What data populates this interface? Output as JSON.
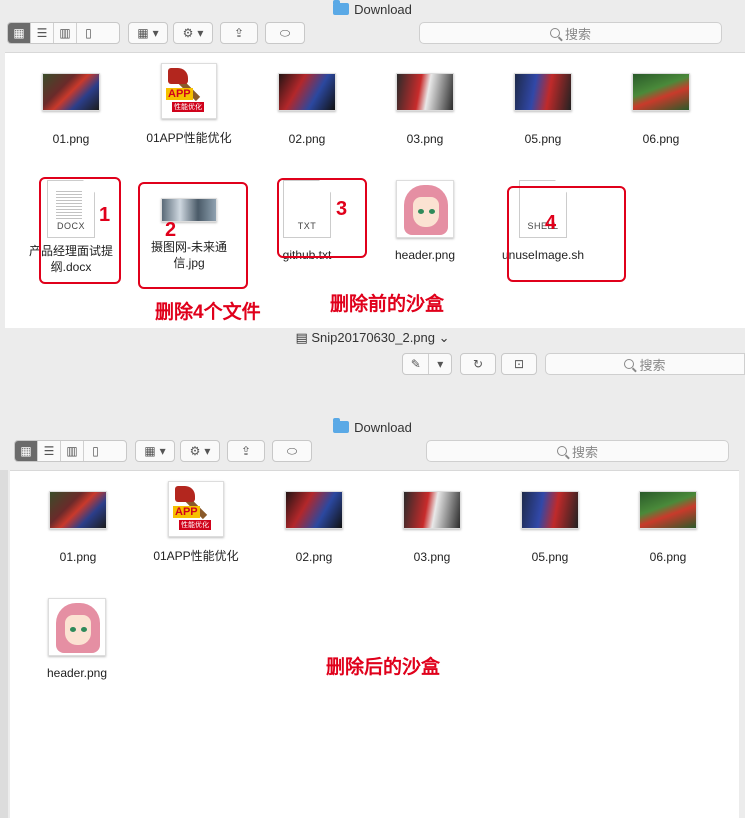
{
  "top": {
    "title": "Download",
    "search_placeholder": "搜索",
    "files": [
      {
        "name": "01.png"
      },
      {
        "name": "01APP性能优化"
      },
      {
        "name": "02.png"
      },
      {
        "name": "03.png"
      },
      {
        "name": "05.png"
      },
      {
        "name": "06.png"
      },
      {
        "name": "产品经理面试提纲.docx",
        "line1": "产品经理面试提",
        "line2": "纲.docx",
        "doc_label": "DOCX"
      },
      {
        "name": "摄图网-未来通信.jpg",
        "line1": "摄图网-未来通",
        "line2": "信.jpg"
      },
      {
        "name": "github.txt",
        "doc_label": "TXT"
      },
      {
        "name": "header.png"
      },
      {
        "name": "unuseImage.sh",
        "doc_label": "SHELL"
      }
    ],
    "app_badge": "APP",
    "app_badge_sub": "性能优化",
    "markers": [
      "1",
      "2",
      "3",
      "4"
    ],
    "annotation_left": "删除4个文件",
    "annotation_right": "删除前的沙盒"
  },
  "preview": {
    "title": "Snip20170630_2.png",
    "search_placeholder": "搜索"
  },
  "bottom": {
    "title": "Download",
    "search_placeholder": "搜索",
    "files": [
      {
        "name": "01.png"
      },
      {
        "name": "01APP性能优化"
      },
      {
        "name": "02.png"
      },
      {
        "name": "03.png"
      },
      {
        "name": "05.png"
      },
      {
        "name": "06.png"
      },
      {
        "name": "header.png"
      }
    ],
    "annotation": "删除后的沙盒"
  }
}
